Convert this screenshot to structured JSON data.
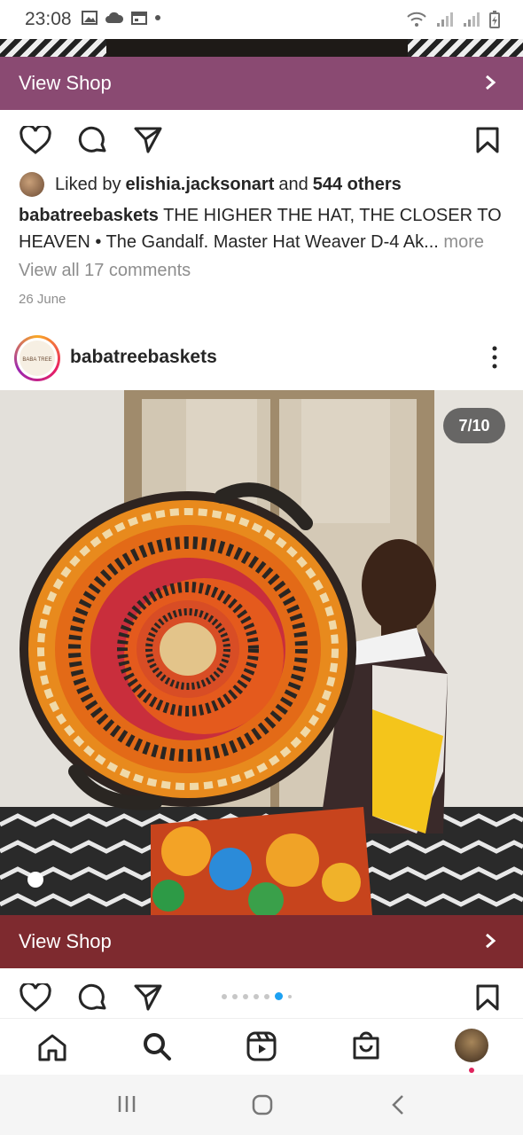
{
  "status_bar": {
    "time": "23:08",
    "left_icons": [
      "gallery-icon",
      "cloud-icon",
      "calendar-icon",
      "dot-icon"
    ],
    "right_icons": [
      "wifi-icon",
      "signal-icon",
      "signal-icon",
      "battery-charging-icon"
    ]
  },
  "post1": {
    "view_shop_label": "View Shop",
    "shop_bar_color": "#8a4a72",
    "liked_prefix": "Liked by",
    "liked_user": "elishia.jacksonart",
    "liked_and": "and",
    "liked_others": "544 others",
    "caption_user": "babatreebaskets",
    "caption_text": "THE HIGHER THE HAT, THE CLOSER TO HEAVEN • The Gandalf. Master Hat Weaver D-4 Ak...",
    "caption_more": "more",
    "view_comments": "View all 17 comments",
    "date": "26 June"
  },
  "post2": {
    "username": "babatreebaskets",
    "avatar_text": "BABA TREE",
    "image_counter": "7/10",
    "view_shop_label": "View Shop",
    "shop_bar_color": "#7e2a2f",
    "carousel": {
      "count": 7,
      "active_index": 5
    }
  },
  "bottom_nav": [
    "home-icon",
    "search-icon",
    "reels-icon",
    "shop-icon",
    "profile-avatar"
  ],
  "system_nav": [
    "recents-icon",
    "home-circle-icon",
    "back-icon"
  ]
}
